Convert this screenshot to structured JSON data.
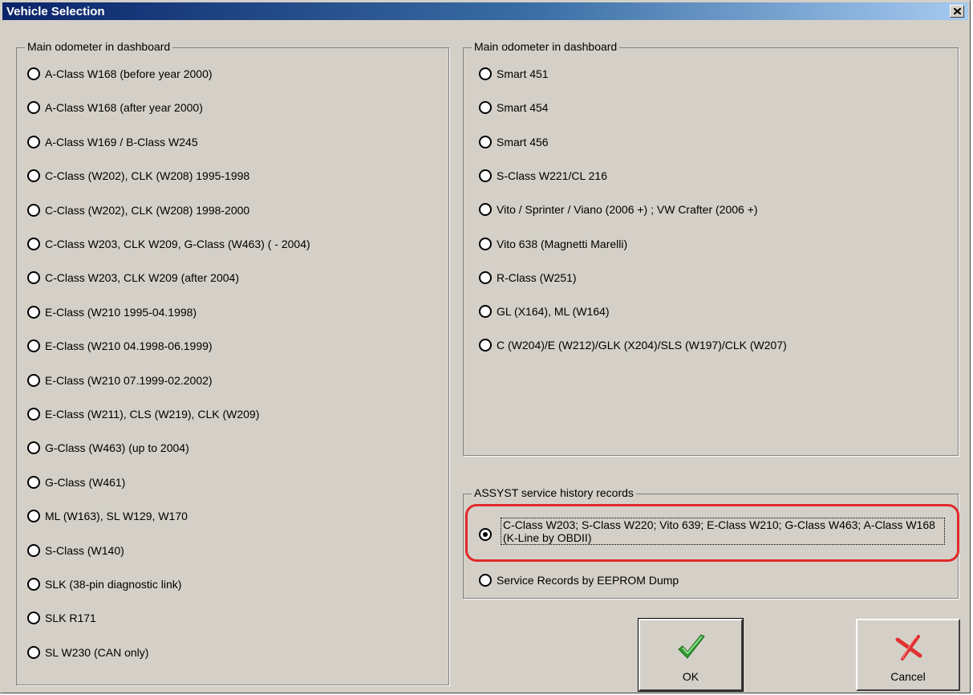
{
  "window": {
    "title": "Vehicle Selection"
  },
  "left_group": {
    "label": "Main odometer in dashboard",
    "options": [
      "A-Class W168 (before year 2000)",
      "A-Class W168 (after year 2000)",
      "A-Class W169 / B-Class W245",
      "C-Class (W202), CLK (W208)  1995-1998",
      "C-Class (W202), CLK (W208)  1998-2000",
      "C-Class W203, CLK W209, G-Class (W463) ( - 2004)",
      "C-Class W203, CLK W209 (after 2004)",
      "E-Class (W210 1995-04.1998)",
      "E-Class (W210 04.1998-06.1999)",
      "E-Class (W210 07.1999-02.2002)",
      "E-Class (W211), CLS (W219), CLK (W209)",
      "G-Class (W463) (up to 2004)",
      "G-Class (W461)",
      "ML (W163), SL W129, W170",
      "S-Class (W140)",
      "SLK (38-pin diagnostic link)",
      "SLK R171",
      "SL W230 (CAN only)"
    ]
  },
  "right_group": {
    "label": "Main odometer in dashboard",
    "options": [
      "Smart 451",
      "Smart 454",
      "Smart 456",
      "S-Class W221/CL 216",
      "Vito / Sprinter / Viano (2006 +) ; VW Crafter (2006 +)",
      "Vito 638 (Magnetti Marelli)",
      "R-Class (W251)",
      "GL (X164), ML (W164)",
      "C (W204)/E (W212)/GLK (X204)/SLS (W197)/CLK (W207)"
    ]
  },
  "assyst_group": {
    "label": "ASSYST service history records",
    "option1": "C-Class W203; S-Class W220; Vito 639; E-Class W210; G-Class W463; A-Class W168 (K-Line by OBDII)",
    "option2": "Service Records by EEPROM Dump",
    "selected": "option1"
  },
  "buttons": {
    "ok_label": "OK",
    "cancel_label": "Cancel",
    "ok_icon": "checkmark-icon",
    "cancel_icon": "x-cross-icon"
  },
  "colors": {
    "title_gradient_start": "#0a246a",
    "title_gradient_end": "#a6caf0",
    "highlight": "#e02a2a",
    "ok_check": "#2e9a2e",
    "cancel_x": "#e03030"
  }
}
